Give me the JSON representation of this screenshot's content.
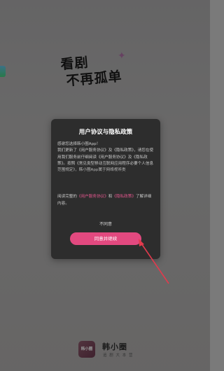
{
  "splash": {
    "slogan_line1": "看剧",
    "slogan_line2": "不再孤单"
  },
  "dialog": {
    "title": "用户协议与隐私政策",
    "body": [
      "感谢您选择韩小圈App！",
      "我们更新了《用户服务协议》及《隐私政策》，请您在使用我们服务前仔细阅读《用户服务协议》及《隐私政策》。按照《常见类型移动互联网应用程序必要个人信息范围规定》，韩小圈App属于网络视听类"
    ],
    "footer": {
      "prefix": "阅读完整的",
      "user_agreement_link": "《用户服务协议》",
      "and": "和",
      "privacy_link": "《隐私政策》",
      "suffix": "了解详细内容。"
    },
    "disagree_label": "不同意",
    "agree_label": "同意并继续"
  },
  "brand": {
    "logo_text": "韩小圈",
    "name": "韩小圈",
    "tagline": "追 剧 大 本 营"
  },
  "colors": {
    "accent": "#e2497f",
    "link": "#e6578f",
    "dialog_bg": "#2d2d2d"
  }
}
